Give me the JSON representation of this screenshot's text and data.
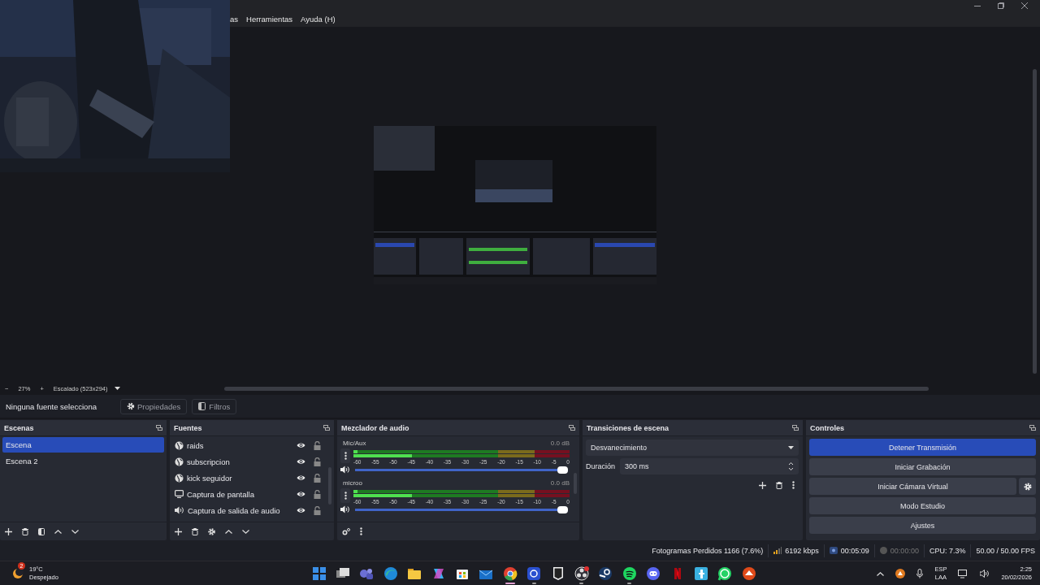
{
  "camera_overlay": {
    "kind": "picture"
  },
  "menu": [
    "as",
    "Herramientas",
    "Ayuda (H)"
  ],
  "preview": {
    "kind": "picture"
  },
  "zoom_bar": {
    "zoom_out": "−",
    "zoom": "27%",
    "zoom_in": "+",
    "scale": "Escalado (523x294)"
  },
  "context_bar": {
    "label": "Ninguna fuente selecciona",
    "buttons": [
      {
        "kind": "properties",
        "label": "Propiedades"
      },
      {
        "kind": "filters",
        "label": "Filtros"
      }
    ]
  },
  "scenes": {
    "title": "Escenas",
    "items": [
      {
        "label": "Escena",
        "selected": true
      },
      {
        "label": "Escena 2",
        "selected": false
      }
    ]
  },
  "sources": {
    "title": "Fuentes",
    "items": [
      {
        "label": "raids",
        "kind": "browser",
        "visible": true,
        "locked": false
      },
      {
        "label": "subscripcion",
        "kind": "browser",
        "visible": true,
        "locked": false
      },
      {
        "label": "kick seguidor",
        "kind": "browser",
        "visible": true,
        "locked": false
      },
      {
        "label": "Captura de pantalla",
        "kind": "display",
        "visible": true,
        "locked": false
      },
      {
        "label": "Captura de salida de audio",
        "kind": "audio",
        "visible": true,
        "locked": false
      }
    ]
  },
  "mixer": {
    "title": "Mezclador de audio",
    "channels": [
      {
        "name": "Mic/Aux",
        "reading": "0.0 dB",
        "meters": [
          {
            "level": 0.02
          },
          {
            "level": 0.27
          }
        ],
        "scale": [
          "-60",
          "-55",
          "-50",
          "-45",
          "-40",
          "-35",
          "-30",
          "-25",
          "-20",
          "-15",
          "-10",
          "-5",
          "0"
        ],
        "volume": {
          "level": 1
        }
      },
      {
        "name": "microo",
        "reading": "0.0 dB",
        "meters": [
          {
            "level": 0.02
          },
          {
            "level": 0.27
          }
        ],
        "scale": [
          "-60",
          "-55",
          "-50",
          "-45",
          "-40",
          "-35",
          "-30",
          "-25",
          "-20",
          "-15",
          "-10",
          "-5",
          "0"
        ],
        "volume": {
          "level": 1
        }
      }
    ]
  },
  "transitions": {
    "title": "Transiciones de escena",
    "transition": "Desvanecimiento",
    "duration_label": "Duración",
    "duration": "300 ms"
  },
  "controls": {
    "title": "Controles",
    "buttons": [
      {
        "label": "Detener Transmisión",
        "active": true,
        "settings": false
      },
      {
        "label": "Iniciar Grabación",
        "active": false,
        "settings": false
      },
      {
        "label": "Iniciar Cámara Virtual",
        "active": false,
        "settings": true
      },
      {
        "label": "Modo Estudio",
        "active": false,
        "settings": false
      },
      {
        "label": "Ajustes",
        "active": false,
        "settings": false
      }
    ]
  },
  "status_bar": {
    "dropped": "Fotogramas Perdidos 1166 (7.6%)",
    "bitrate": "6192 kbps",
    "stream_time": "00:05:09",
    "record_time": "00:00:00",
    "cpu": "CPU: 7.3%",
    "fps": "50.00 / 50.00 FPS"
  },
  "taskbar": {
    "weather": {
      "badge": "2",
      "temperature": "19°C",
      "condition": "Despejado"
    },
    "apps": [
      {
        "kind": "start",
        "running": false,
        "focused": false
      },
      {
        "kind": "taskview",
        "running": false,
        "focused": false
      },
      {
        "kind": "teams",
        "running": false,
        "focused": false
      },
      {
        "kind": "edge",
        "running": false,
        "focused": false
      },
      {
        "kind": "folder",
        "running": false,
        "focused": false
      },
      {
        "kind": "copilot",
        "running": false,
        "focused": false
      },
      {
        "kind": "store",
        "running": false,
        "focused": false
      },
      {
        "kind": "mail",
        "running": false,
        "focused": false
      },
      {
        "kind": "chrome",
        "running": true,
        "focused": true
      },
      {
        "kind": "bluebox",
        "running": true,
        "focused": false
      },
      {
        "kind": "epic",
        "running": false,
        "focused": false
      },
      {
        "kind": "obs",
        "running": true,
        "focused": false
      },
      {
        "kind": "steam",
        "running": false,
        "focused": false
      },
      {
        "kind": "spotify",
        "running": true,
        "focused": false
      },
      {
        "kind": "discord",
        "running": false,
        "focused": false
      },
      {
        "kind": "netflix",
        "running": false,
        "focused": false
      },
      {
        "kind": "cyan",
        "running": false,
        "focused": false
      },
      {
        "kind": "whatsapp",
        "running": false,
        "focused": false
      },
      {
        "kind": "orange",
        "running": false,
        "focused": false
      }
    ],
    "language": "ESP",
    "layout": "LAA",
    "time": "2:25",
    "date": "20/02/2026"
  }
}
